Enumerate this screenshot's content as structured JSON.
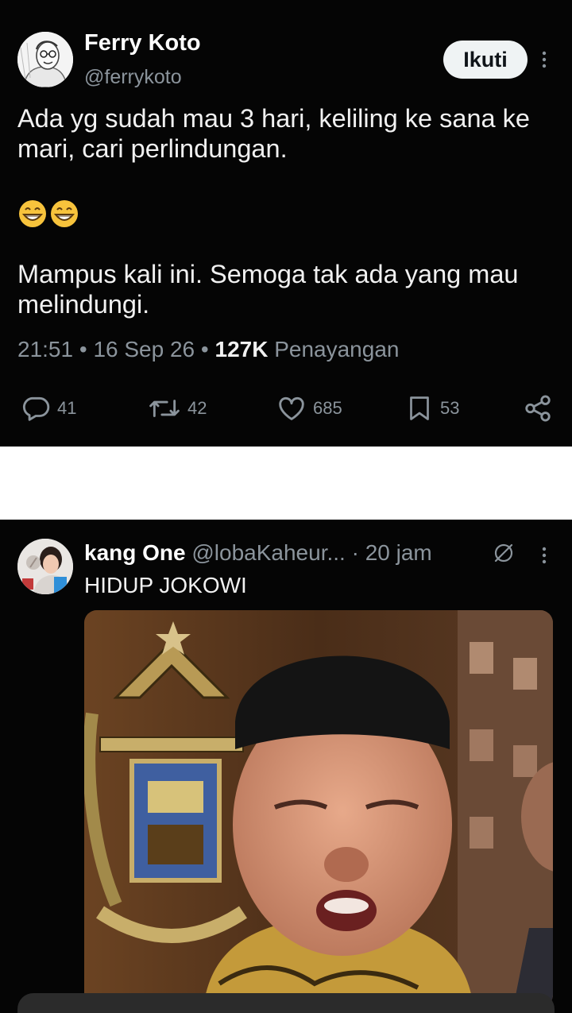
{
  "tweet1": {
    "author_name": "Ferry Koto",
    "author_handle": "@ferrykoto",
    "follow_label": "Ikuti",
    "text_line1": "Ada yg sudah mau 3 hari, keliling ke sana ke mari, cari perlindungan.",
    "emojis": "😁😁",
    "text_line2": "Mampus kali ini. Semoga tak ada yang mau melindungi.",
    "time": "21:51",
    "date": "16 Sep 26",
    "views_count": "127K",
    "views_label": "Penayangan",
    "replies": "41",
    "retweets": "42",
    "likes": "685",
    "bookmarks": "53"
  },
  "tweet2": {
    "author_name": "kang One",
    "author_handle": "@lobaKaheur...",
    "time": "· 20 jam",
    "text": "HIDUP JOKOWI"
  },
  "colors": {
    "background": "#050505",
    "text_primary": "#e7e9ea",
    "text_secondary": "#8b949c",
    "follow_button_bg": "#eff3f4"
  },
  "icons": [
    "reply-icon",
    "retweet-icon",
    "like-icon",
    "bookmark-icon",
    "share-icon",
    "more-icon",
    "grok-icon"
  ]
}
